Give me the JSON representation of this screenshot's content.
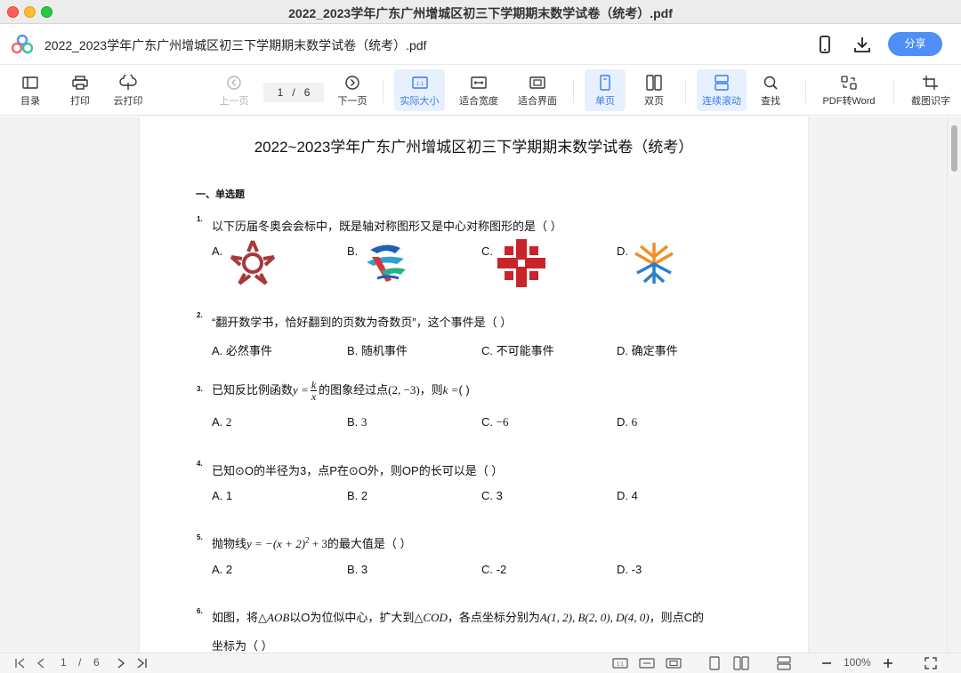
{
  "window": {
    "title": "2022_2023学年广东广州增城区初三下学期期末数学试卷（统考）.pdf"
  },
  "header": {
    "doc_title": "2022_2023学年广东广州增城区初三下学期期末数学试卷（统考）.pdf",
    "share_label": "分享",
    "icons": [
      "phone-icon",
      "download-icon"
    ]
  },
  "toolbar": {
    "toc": "目录",
    "print": "打印",
    "cloud_print": "云打印",
    "prev_page": "上一页",
    "page_current": "1",
    "page_sep": "/",
    "page_total": "6",
    "next_page": "下一页",
    "actual_size": "实际大小",
    "fit_width": "适合宽度",
    "fit_page": "适合界面",
    "single_page": "单页",
    "double_page": "双页",
    "continuous": "连续滚动",
    "search": "查找",
    "pdf_to_word": "PDF转Word",
    "ocr": "截图识字",
    "active_color": "#3a7bea"
  },
  "document": {
    "title": "2022~2023学年广东广州增城区初三下学期期末数学试卷（统考）",
    "section": "一、单选题",
    "q1": {
      "num": "1.",
      "text": "以下历届冬奥会会标中，既是轴对称图形又是中心对称图形的是（    ）",
      "a": "A.",
      "b": "B.",
      "c": "C.",
      "d": "D."
    },
    "q2": {
      "num": "2.",
      "text": "“翻开数学书，恰好翻到的页数为奇数页”，这个事件是（        ）",
      "a": "A. 必然事件",
      "b": "B. 随机事件",
      "c": "C. 不可能事件",
      "d": "D. 确定事件"
    },
    "q3": {
      "num": "3.",
      "pre": "已知反比例函数",
      "y_eq": "y =",
      "frac_num": "k",
      "frac_den": "x",
      "mid": "的图象经过点",
      "point": "(2, −3)",
      "comma": "，则",
      "k_eq": "k =",
      "post": "(    )",
      "a_pre": "A. ",
      "a_val": "2",
      "b_pre": "B. ",
      "b_val": "3",
      "c_pre": "C. ",
      "c_val": "−6",
      "d_pre": "D. ",
      "d_val": "6"
    },
    "q4": {
      "num": "4.",
      "text": "已知⊙O的半径为3，点P在⊙O外，则OP的长可以是（        ）",
      "a": "A. 1",
      "b": "B. 2",
      "c": "C. 3",
      "d": "D. 4"
    },
    "q5": {
      "num": "5.",
      "pre": "抛物线",
      "expr": "y = −(x + 2)",
      "sup": "2",
      "expr2": " + 3",
      "post": "的最大值是（            ）",
      "a": "A. 2",
      "b": "B. 3",
      "c": "C. -2",
      "d": "D. -3"
    },
    "q6": {
      "num": "6.",
      "pre": "如图，将",
      "tri1": "△AOB",
      "mid1": "以O为位似中心，扩大到",
      "tri2": "△COD",
      "mid2": "，各点坐标分别为",
      "coords": "A(1, 2), B(2, 0), D(4, 0)",
      "post": "，则点C的",
      "line2": "坐标为（        ）"
    }
  },
  "statusbar": {
    "page_current": "1",
    "page_sep": "/",
    "page_total": "6",
    "zoom": "100%"
  }
}
